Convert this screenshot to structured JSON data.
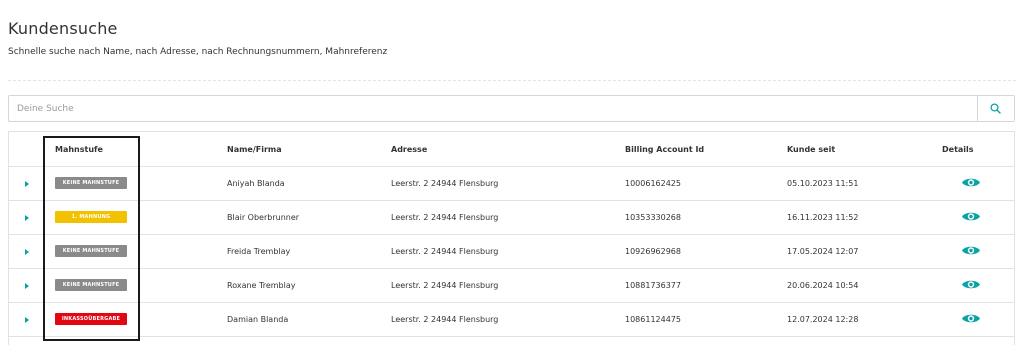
{
  "header": {
    "title": "Kundensuche",
    "subtitle": "Schnelle suche nach Name, nach Adresse, nach Rechnungsnummern, Mahnreferenz"
  },
  "search": {
    "placeholder": "Deine Suche",
    "value": "",
    "button_icon": "search-icon"
  },
  "colors": {
    "accent": "#0aa3a3",
    "badge_none": "#8a8a8a",
    "badge_first": "#f2c200",
    "badge_collection": "#e30613"
  },
  "table": {
    "columns": [
      "Mahnstufe",
      "Name/Firma",
      "Adresse",
      "Billing Account Id",
      "Kunde seit",
      "Details"
    ],
    "rows": [
      {
        "mahnstufe": "KEINE MAHNSTUFE",
        "level": "none",
        "name": "Aniyah Blanda",
        "address": "Leerstr. 2 24944 Flensburg",
        "billing_id": "10006162425",
        "since": "05.10.2023 11:51"
      },
      {
        "mahnstufe": "1. MAHNUNG",
        "level": "first",
        "name": "Blair Oberbrunner",
        "address": "Leerstr. 2 24944 Flensburg",
        "billing_id": "10353330268",
        "since": "16.11.2023 11:52"
      },
      {
        "mahnstufe": "KEINE MAHNSTUFE",
        "level": "none",
        "name": "Freida Tremblay",
        "address": "Leerstr. 2 24944 Flensburg",
        "billing_id": "10926962968",
        "since": "17.05.2024 12:07"
      },
      {
        "mahnstufe": "KEINE MAHNSTUFE",
        "level": "none",
        "name": "Roxane Tremblay",
        "address": "Leerstr. 2 24944 Flensburg",
        "billing_id": "10881736377",
        "since": "20.06.2024 10:54"
      },
      {
        "mahnstufe": "INKASSOÜBERGABE",
        "level": "collection",
        "name": "Damian Blanda",
        "address": "Leerstr. 2 24944 Flensburg",
        "billing_id": "10861124475",
        "since": "12.07.2024 12:28"
      }
    ]
  }
}
